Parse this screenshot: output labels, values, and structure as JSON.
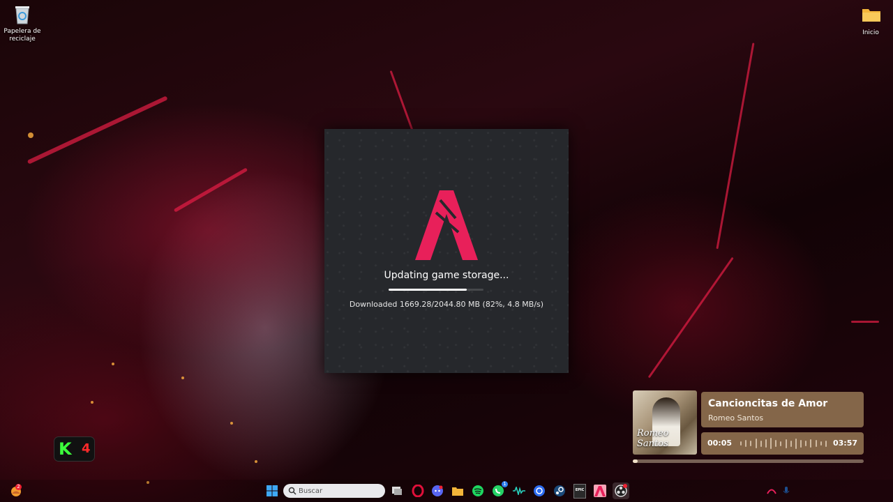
{
  "desktop": {
    "icons": [
      {
        "label": "Papelera de reciclaje"
      },
      {
        "label": "Inicio"
      }
    ]
  },
  "updater": {
    "status": "Updating game storage...",
    "progress": 0.82,
    "detail": "Downloaded 1669.28/2044.80 MB (82%, 4.8 MB/s)",
    "accent_color": "#e8205a"
  },
  "k4_widget": {
    "letter": "K",
    "number": "4"
  },
  "media": {
    "title": "Cancioncitas de Amor",
    "artist": "Romeo Santos",
    "current_time": "00:05",
    "duration": "03:57",
    "art_text": "Romeo Santos",
    "seek_progress": 0.02
  },
  "taskbar": {
    "weather_badge": "2",
    "search_placeholder": "Buscar",
    "whatsapp_badge": "1",
    "epic_label": "EPIC",
    "apps": [
      "windows-start-icon",
      "search",
      "task-view-icon",
      "opera-gx-icon",
      "discord-icon",
      "file-explorer-icon",
      "spotify-icon",
      "whatsapp-icon",
      "waveform-app-icon",
      "web-app-icon",
      "steam-icon",
      "epic-games-icon",
      "fivem-icon",
      "obs-icon"
    ]
  }
}
